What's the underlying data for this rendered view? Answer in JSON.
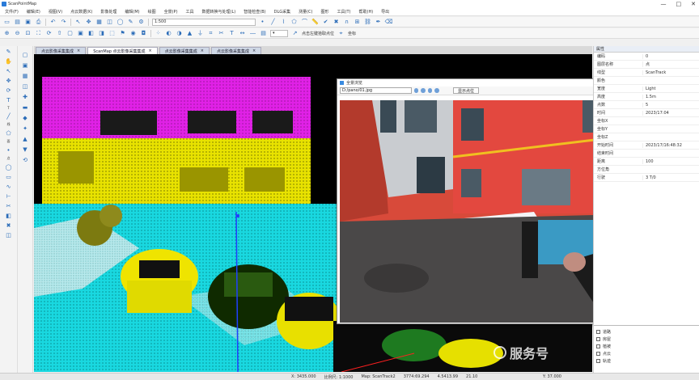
{
  "window": {
    "title": "ScanPointMap",
    "minimize": "—",
    "maximize": "□",
    "close": "✕"
  },
  "menu": [
    "文件(F)",
    "编辑(E)",
    "视图(V)",
    "点云数据(K)",
    "影像处理",
    "编辑(M)",
    "绘图",
    "全景(P)",
    "工具",
    "数据转换与处理(L)",
    "智能检查(B)",
    "DLG采集",
    "测量(C)",
    "图形",
    "工具(T)",
    "帮助(H)",
    "导出"
  ],
  "toolbar1": {
    "scale_combo": "1:500"
  },
  "toolbar2": {
    "hint": "点击左键拾取点位",
    "mode": "坐标"
  },
  "left_tools": [
    {
      "icon": "pen-icon",
      "label": ""
    },
    {
      "icon": "hand-icon",
      "label": ""
    },
    {
      "icon": "arrow-icon",
      "label": ""
    },
    {
      "icon": "move-icon",
      "label": ""
    },
    {
      "icon": "rotate-icon",
      "label": ""
    },
    {
      "icon": "text-icon",
      "label": "T"
    },
    {
      "icon": "line-icon",
      "label": "线"
    },
    {
      "icon": "poly-icon",
      "label": "面"
    },
    {
      "icon": "point-icon",
      "label": "点"
    },
    {
      "icon": "circle-icon",
      "label": ""
    },
    {
      "icon": "rect-icon",
      "label": ""
    },
    {
      "icon": "curve-icon",
      "label": ""
    },
    {
      "icon": "measure-icon",
      "label": ""
    },
    {
      "icon": "cut-icon",
      "label": ""
    },
    {
      "icon": "fill-icon",
      "label": ""
    },
    {
      "icon": "delete-icon",
      "label": ""
    },
    {
      "icon": "layer-icon",
      "label": ""
    }
  ],
  "tabs": [
    {
      "label": "点云影像采集集成",
      "active": false
    },
    {
      "label": "ScanMap 点云影像采集集成",
      "active": true
    },
    {
      "label": "点云影像采集集成",
      "active": false
    },
    {
      "label": "点云影像采集集成",
      "active": false
    }
  ],
  "popup": {
    "title": "全景浏览",
    "path": "D:/pano/01.jpg",
    "button1": "显示点位",
    "button2": "设置"
  },
  "right_panel": {
    "header": "属性",
    "rows": [
      {
        "k": "编码",
        "v": "0"
      },
      {
        "k": "图层名称",
        "v": "点"
      },
      {
        "k": "线型",
        "v": "ScanTrack"
      },
      {
        "k": "颜色",
        "v": ""
      },
      {
        "k": "宽度",
        "v": "Light"
      },
      {
        "k": "高度",
        "v": "1.5m"
      },
      {
        "k": "点数",
        "v": "5"
      },
      {
        "k": "时间",
        "v": "2023/17:04"
      },
      {
        "k": "坐标X",
        "v": ""
      },
      {
        "k": "坐标Y",
        "v": ""
      },
      {
        "k": "坐标Z",
        "v": ""
      },
      {
        "k": "开始时间",
        "v": "2023/17/16:48:32"
      },
      {
        "k": "结束时间",
        "v": ""
      },
      {
        "k": "距离",
        "v": "100"
      },
      {
        "k": "方位角",
        "v": ""
      },
      {
        "k": "行驶",
        "v": "3 T/0"
      }
    ],
    "layers": [
      "道路",
      "房屋",
      "植被",
      "点云",
      "轨迹"
    ]
  },
  "status": {
    "coord": "X: 3435.000",
    "scale": "比例尺: 1:1000",
    "map": "Map: ScanTrack2",
    "x": "3774:69.294",
    "y": "4.5413.99",
    "z": "21.10",
    "right": "Y: 37.000"
  },
  "watermark": "服务号"
}
